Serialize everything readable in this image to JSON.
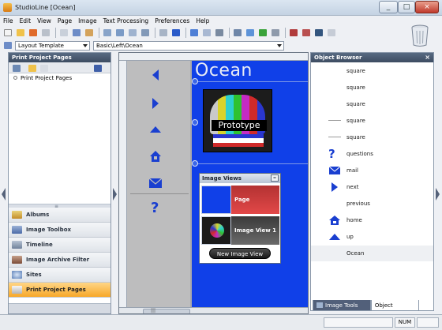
{
  "window": {
    "title": "StudioLine [Ocean]",
    "minimize": "_",
    "maximize": "□",
    "close": "×"
  },
  "menu": [
    "File",
    "Edit",
    "View",
    "Page",
    "Image",
    "Text Processing",
    "Preferences",
    "Help"
  ],
  "address": {
    "template_label": "Layout Template",
    "path": "Basic\\Left\\Ocean"
  },
  "left_panel": {
    "header": "Print Project Pages",
    "tree_item": "Print Project Pages",
    "nav": [
      "Albums",
      "Image Toolbox",
      "Timeline",
      "Image Archive Filter",
      "Sites",
      "Print Project Pages"
    ],
    "footer_mark": "≡"
  },
  "canvas": {
    "title": "Ocean",
    "prototype_label": "Prototype",
    "image_views": {
      "header": "Image Views",
      "minimize": "–",
      "items": [
        "Page",
        "Image View 1"
      ],
      "new_button": "New Image View"
    },
    "scroll_mark": "|||"
  },
  "object_browser": {
    "header": "Object Browser",
    "close": "×",
    "items": [
      "square",
      "square",
      "square",
      "square",
      "square",
      "questions",
      "mail",
      "next",
      "previous",
      "home",
      "up",
      "Ocean"
    ],
    "tabs": [
      "Image Tools Bar",
      "Object Browser"
    ]
  },
  "status": {
    "num": "NUM"
  },
  "colors": {
    "canvas_blue": "#1040e8",
    "header_dark": "#3d4c61",
    "active_nav": "#f7a829",
    "icon_blue": "#1a3fd0"
  }
}
